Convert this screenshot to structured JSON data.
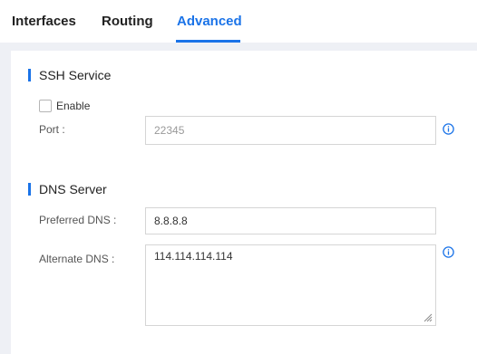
{
  "tabs": [
    {
      "label": "Interfaces"
    },
    {
      "label": "Routing"
    },
    {
      "label": "Advanced"
    }
  ],
  "active_tab": "Advanced",
  "ssh": {
    "title": "SSH Service",
    "enable_label": "Enable",
    "enabled": false,
    "port_label": "Port :",
    "port_value": "22345"
  },
  "dns": {
    "title": "DNS Server",
    "preferred_label": "Preferred DNS :",
    "preferred_value": "8.8.8.8",
    "alternate_label": "Alternate DNS :",
    "alternate_value": "114.114.114.114"
  },
  "icons": {
    "port_help": "info-icon",
    "alternate_help": "info-icon"
  },
  "colors": {
    "accent": "#1a73e8",
    "background": "#eef0f5"
  }
}
